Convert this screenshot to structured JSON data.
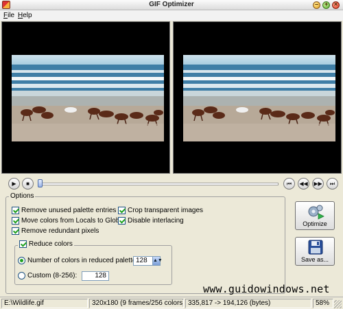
{
  "window": {
    "title": "GIF Optimizer"
  },
  "menu": [
    "File",
    "Help"
  ],
  "playback": {
    "play_icon": "play-icon",
    "stop_icon": "stop-icon",
    "first_icon": "first-frame-icon",
    "prev_icon": "previous-frame-icon",
    "next_icon": "next-frame-icon",
    "last_icon": "last-frame-icon",
    "position": 0
  },
  "options": {
    "title": "Options",
    "checks": [
      {
        "label": "Remove unused palette entries",
        "checked": true
      },
      {
        "label": "Move colors from Locals to Global",
        "checked": true
      },
      {
        "label": "Remove redundant pixels",
        "checked": true
      },
      {
        "label": "Crop transparent images",
        "checked": true
      },
      {
        "label": "Disable interlacing",
        "checked": true
      }
    ],
    "reduce": {
      "label": "Reduce colors",
      "checked": true,
      "radio_palette_label": "Number of colors in reduced palette:",
      "palette_value": "128",
      "radio_custom_label": "Custom (8-256):",
      "custom_value": "128"
    }
  },
  "buttons": {
    "optimize": "Optimize",
    "save_as": "Save as..."
  },
  "watermark": "www.guidowindows.net",
  "status": {
    "file": "E:\\Wildlife.gif",
    "info": "320x180 (9 frames/256 colors)",
    "bytes": "335,817 -> 194,126 (bytes)",
    "percent": "58%"
  },
  "colors": {
    "check": "#21a121",
    "accent": "#1c5180"
  }
}
